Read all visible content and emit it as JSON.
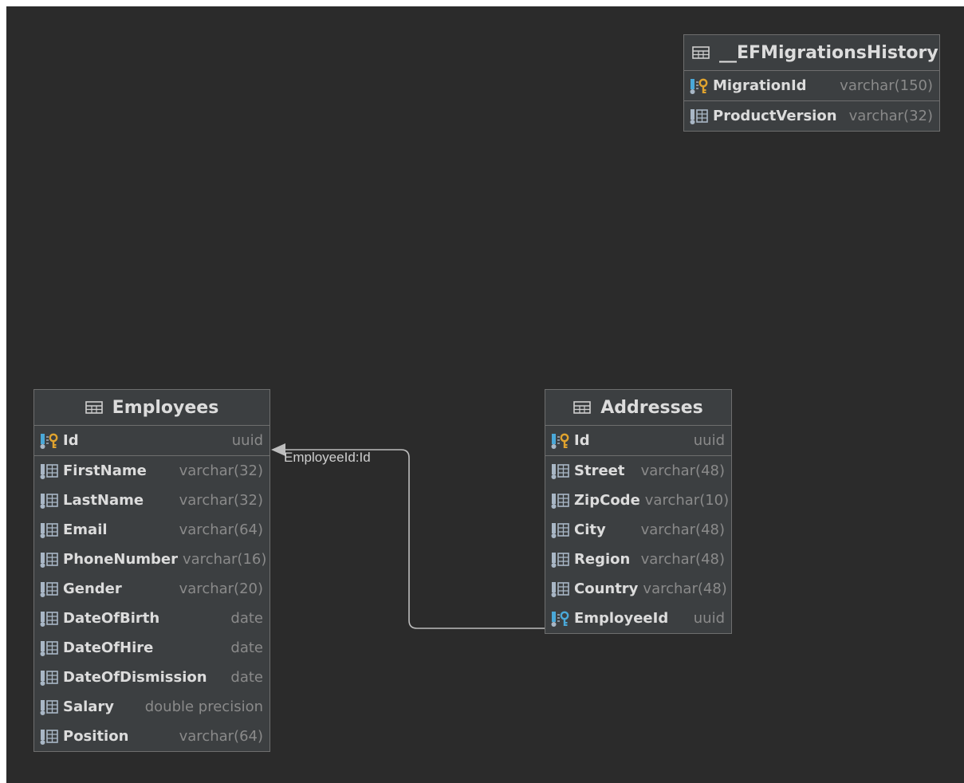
{
  "diagram": {
    "relation_label": "EmployeeId:Id",
    "tables": {
      "migrations": {
        "name": "__EFMigrationsHistory",
        "columns": [
          {
            "name": "MigrationId",
            "type": "varchar(150)",
            "key": "pk"
          },
          {
            "name": "ProductVersion",
            "type": "varchar(32)",
            "key": "none"
          }
        ]
      },
      "employees": {
        "name": "Employees",
        "columns": [
          {
            "name": "Id",
            "type": "uuid",
            "key": "pk"
          },
          {
            "name": "FirstName",
            "type": "varchar(32)",
            "key": "none"
          },
          {
            "name": "LastName",
            "type": "varchar(32)",
            "key": "none"
          },
          {
            "name": "Email",
            "type": "varchar(64)",
            "key": "none"
          },
          {
            "name": "PhoneNumber",
            "type": "varchar(16)",
            "key": "none"
          },
          {
            "name": "Gender",
            "type": "varchar(20)",
            "key": "none"
          },
          {
            "name": "DateOfBirth",
            "type": "date",
            "key": "none"
          },
          {
            "name": "DateOfHire",
            "type": "date",
            "key": "none"
          },
          {
            "name": "DateOfDismission",
            "type": "date",
            "key": "none"
          },
          {
            "name": "Salary",
            "type": "double precision",
            "key": "none"
          },
          {
            "name": "Position",
            "type": "varchar(64)",
            "key": "none"
          }
        ]
      },
      "addresses": {
        "name": "Addresses",
        "columns": [
          {
            "name": "Id",
            "type": "uuid",
            "key": "pk"
          },
          {
            "name": "Street",
            "type": "varchar(48)",
            "key": "none"
          },
          {
            "name": "ZipCode",
            "type": "varchar(10)",
            "key": "none"
          },
          {
            "name": "City",
            "type": "varchar(48)",
            "key": "none"
          },
          {
            "name": "Region",
            "type": "varchar(48)",
            "key": "none"
          },
          {
            "name": "Country",
            "type": "varchar(48)",
            "key": "none"
          },
          {
            "name": "EmployeeId",
            "type": "uuid",
            "key": "fk"
          }
        ]
      }
    },
    "colors": {
      "background": "#2b2b2b",
      "entity": "#3c3f41",
      "border": "#6e6e6e",
      "key_gold": "#e0a32e",
      "key_blue": "#4aa8d8",
      "column_icon": "#a9b7c6"
    }
  }
}
